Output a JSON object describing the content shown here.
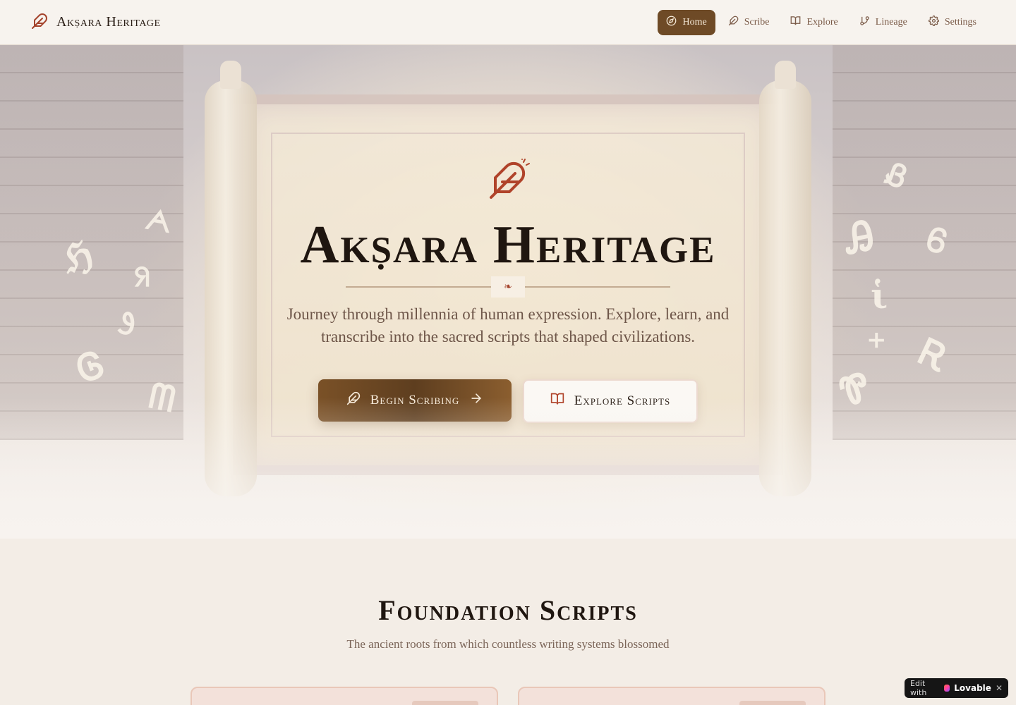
{
  "brand": {
    "name": "Akṣara Heritage"
  },
  "nav": {
    "items": [
      {
        "label": "Home",
        "icon": "compass-icon",
        "active": true
      },
      {
        "label": "Scribe",
        "icon": "feather-icon",
        "active": false
      },
      {
        "label": "Explore",
        "icon": "book-open-icon",
        "active": false
      },
      {
        "label": "Lineage",
        "icon": "git-branch-icon",
        "active": false
      },
      {
        "label": "Settings",
        "icon": "gear-icon",
        "active": false
      }
    ]
  },
  "hero": {
    "title": "Akṣara Heritage",
    "ornament": "❧",
    "subtitle": "Journey through millennia of human expression. Explore, learn, and transcribe into the sacred scripts that shaped civilizations.",
    "primary_cta": "Begin Scribing",
    "secondary_cta": "Explore Scripts",
    "glyphs_left": [
      "ℌ",
      "ᗅ",
      "ᖆ",
      "Ꮽ",
      "Ꮆ",
      "ᗰ"
    ],
    "glyphs_right": [
      "Ᏸ",
      "Ꭿ",
      "Ꮾ",
      "ἱ",
      "+",
      "Ꭱ",
      "Ꮘ"
    ]
  },
  "foundation": {
    "title": "Foundation Scripts",
    "subtitle": "The ancient roots from which countless writing systems blossomed"
  },
  "badge": {
    "prefix": "Edit with",
    "brand": "Lovable",
    "close": "✕"
  },
  "colors": {
    "accent_brown": "#6e4a26",
    "accent_red": "#a4432c",
    "text_dark": "#1f1610",
    "muted_text": "#6e5649"
  }
}
